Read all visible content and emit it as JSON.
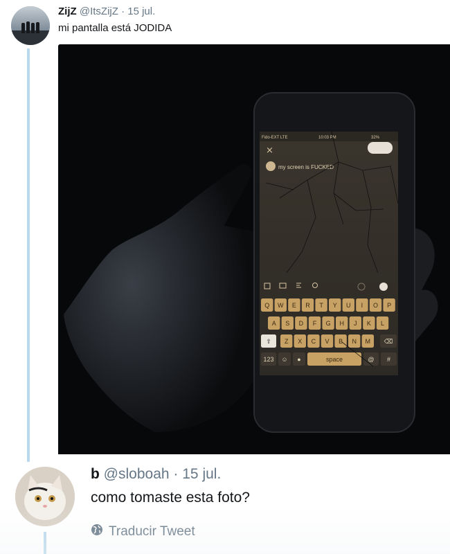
{
  "tweet": {
    "author_name": "ZijZ",
    "handle": "@ItsZijZ",
    "separator": "·",
    "date": "15 jul.",
    "text": "mi pantalla está JODIDA"
  },
  "media": {
    "phone_screen": {
      "carrier": "Fido-EXT  LTE",
      "time": "10:03 PM",
      "battery": "32%",
      "close": "×",
      "draft_text": "my screen is FUCKED",
      "keyboard_row1": [
        "Q",
        "W",
        "E",
        "R",
        "T",
        "Y",
        "U",
        "I",
        "O",
        "P"
      ],
      "keyboard_row2": [
        "A",
        "S",
        "D",
        "F",
        "G",
        "H",
        "J",
        "K",
        "L"
      ],
      "keyboard_row3": [
        "Z",
        "X",
        "C",
        "V",
        "B",
        "N",
        "M"
      ],
      "key_123": "123",
      "key_space": "space",
      "key_at": "@",
      "key_hash": "#"
    }
  },
  "reply": {
    "author_name": "b",
    "handle": "@sloboah",
    "separator": "·",
    "date": "15 jul.",
    "text": "como tomaste esta foto?",
    "translate_label": "Traducir Tweet"
  },
  "icons": [
    "globe-icon",
    "close-icon",
    "image-icon",
    "gif-icon",
    "poll-icon",
    "location-icon",
    "shift-icon",
    "backspace-icon",
    "emoji-icon",
    "mic-icon"
  ],
  "colors": {
    "thread_line": "#b9d9ee",
    "meta_gray": "#657786",
    "key_amber": "#c8a165"
  }
}
